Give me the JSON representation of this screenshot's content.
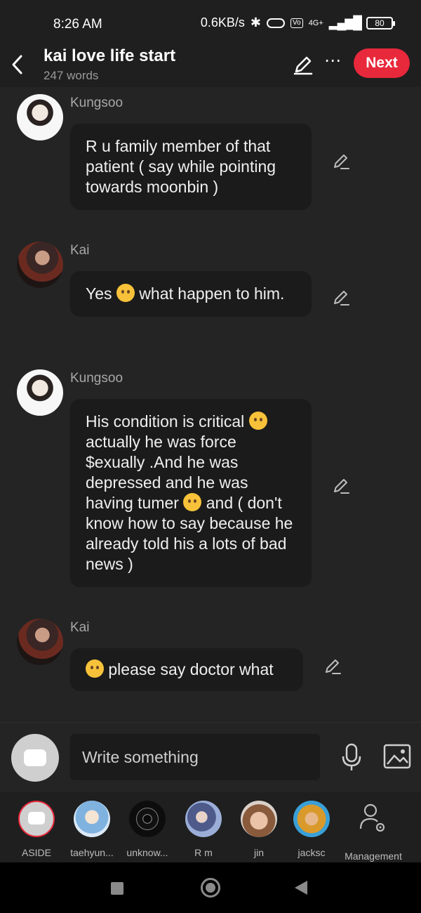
{
  "status": {
    "time": "8:26 AM",
    "net_speed": "0.6KB/s",
    "signal": "4G+",
    "battery": "80"
  },
  "header": {
    "title": "kai love life start",
    "subtitle": "247 words",
    "next_label": "Next"
  },
  "messages": [
    {
      "sender": "Kungsoo",
      "text": "R u family member of that patient ( say while pointing towards moonbin )"
    },
    {
      "sender": "Kai",
      "text_parts": [
        "Yes ",
        " what happen to him."
      ]
    },
    {
      "sender": "Kungsoo",
      "text_parts": [
        "His condition is critical ",
        " actually he was force $exually  .And he was depressed and he was having tumer ",
        " and ( don't know how to say because he already told his a lots of bad news )"
      ]
    },
    {
      "sender": "Kai",
      "text_parts": [
        "",
        " please say doctor what"
      ]
    }
  ],
  "input": {
    "placeholder": "Write something"
  },
  "characters": [
    {
      "name": "ASIDE"
    },
    {
      "name": "taehyun..."
    },
    {
      "name": "unknow..."
    },
    {
      "name": "R m"
    },
    {
      "name": "jin"
    },
    {
      "name": "jacksc"
    },
    {
      "name": "Management"
    }
  ],
  "colors": {
    "accent": "#e8283b",
    "background": "#242424",
    "bubble": "#1b1b1b"
  }
}
